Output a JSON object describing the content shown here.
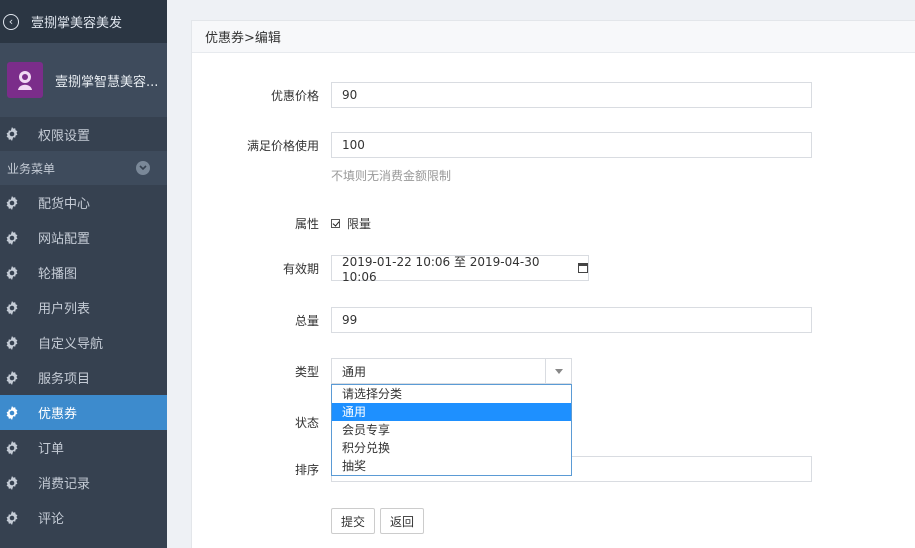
{
  "app": {
    "title": "壹捌掌美容美发"
  },
  "brand": {
    "name": "壹捌掌智慧美容..."
  },
  "sidebar": {
    "top_item": "权限设置",
    "section_label": "业务菜单",
    "items": [
      {
        "label": "配货中心",
        "active": false
      },
      {
        "label": "网站配置",
        "active": false
      },
      {
        "label": "轮播图",
        "active": false
      },
      {
        "label": "用户列表",
        "active": false
      },
      {
        "label": "自定义导航",
        "active": false
      },
      {
        "label": "服务项目",
        "active": false
      },
      {
        "label": "优惠券",
        "active": true
      },
      {
        "label": "订单",
        "active": false
      },
      {
        "label": "消费记录",
        "active": false
      },
      {
        "label": "评论",
        "active": false
      }
    ]
  },
  "panel": {
    "breadcrumb": "优惠券>编辑"
  },
  "form": {
    "price": {
      "label": "优惠价格",
      "value": "90"
    },
    "min_price": {
      "label": "满足价格使用",
      "value": "100",
      "hint": "不填则无消费金额限制"
    },
    "attribute": {
      "label": "属性",
      "checkbox_label": "限量",
      "checked": true
    },
    "validity": {
      "label": "有效期",
      "value": "2019-01-22 10:06 至 2019-04-30 10:06"
    },
    "total": {
      "label": "总量",
      "value": "99"
    },
    "type": {
      "label": "类型",
      "value": "通用",
      "options": [
        "请选择分类",
        "通用",
        "会员专享",
        "积分兑换",
        "抽奖"
      ],
      "selected_index": 1
    },
    "status": {
      "label": "状态"
    },
    "sort": {
      "label": "排序",
      "value": ""
    },
    "submit_label": "提交",
    "back_label": "返回"
  },
  "colors": {
    "sidebar_bg": "#364150",
    "active_bg": "#3d8bcd",
    "dropdown_selected": "#1e90ff"
  }
}
